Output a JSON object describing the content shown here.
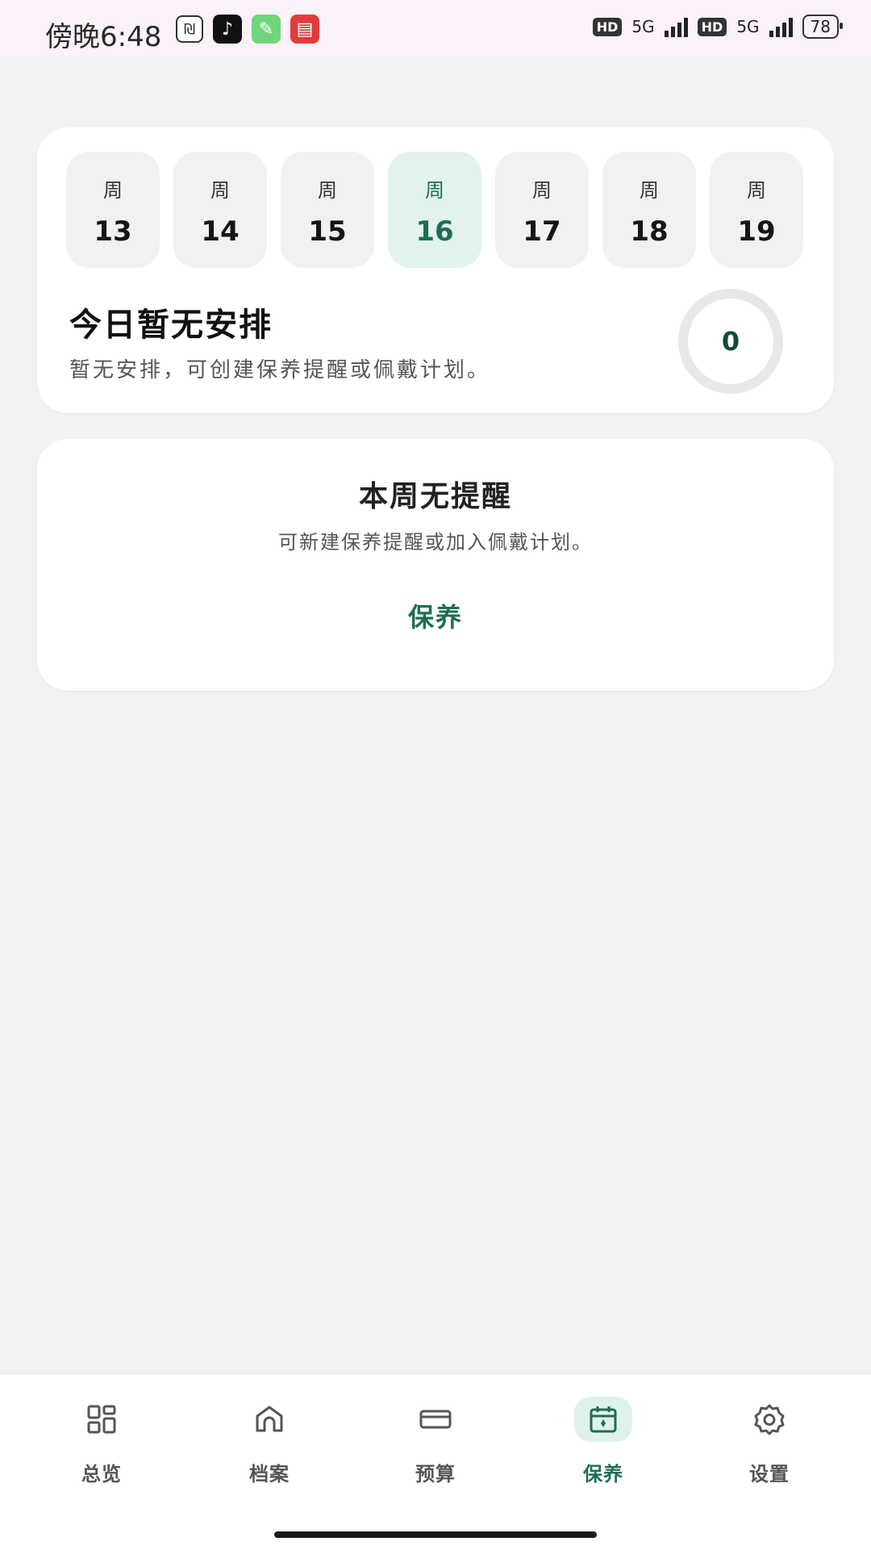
{
  "status_bar": {
    "time": "傍晚6:48",
    "hd1": "HD",
    "net1": "5G",
    "hd2": "HD",
    "net2": "5G",
    "battery": "78"
  },
  "week": {
    "days": [
      {
        "label": "周",
        "num": "13",
        "active": false
      },
      {
        "label": "周",
        "num": "14",
        "active": false
      },
      {
        "label": "周",
        "num": "15",
        "active": false
      },
      {
        "label": "周",
        "num": "16",
        "active": true
      },
      {
        "label": "周",
        "num": "17",
        "active": false
      },
      {
        "label": "周",
        "num": "18",
        "active": false
      },
      {
        "label": "周",
        "num": "19",
        "active": false
      }
    ]
  },
  "today": {
    "title": "今日暂无安排",
    "subtitle": "暂无安排，可创建保养提醒或佩戴计划。",
    "count": "0"
  },
  "week_card": {
    "title": "本周无提醒",
    "subtitle": "可新建保养提醒或加入佩戴计划。",
    "link": "保养"
  },
  "nav": {
    "items": [
      {
        "label": "总览",
        "icon": "grid-icon"
      },
      {
        "label": "档案",
        "icon": "home-icon"
      },
      {
        "label": "预算",
        "icon": "card-icon"
      },
      {
        "label": "保养",
        "icon": "calendar-icon",
        "active": true
      },
      {
        "label": "设置",
        "icon": "gear-icon"
      }
    ]
  },
  "colors": {
    "accent": "#1e6e52",
    "active_bg": "#e2f3ec",
    "background": "#f1f3f2"
  }
}
